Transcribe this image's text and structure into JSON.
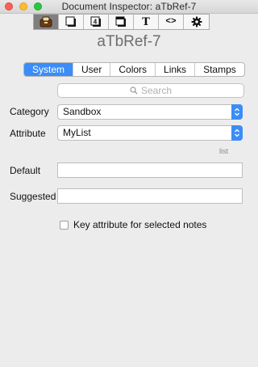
{
  "window": {
    "title": "Document Inspector: aTbRef-7"
  },
  "toolbar": {
    "buttons": [
      {
        "icon": "document-box-icon",
        "active": true
      },
      {
        "icon": "note-icon",
        "active": false
      },
      {
        "icon": "calendar-icon",
        "label": "4",
        "active": false
      },
      {
        "icon": "window-icon",
        "active": false
      },
      {
        "icon": "text-icon",
        "label": "T",
        "active": false
      },
      {
        "icon": "code-icon",
        "label": "<>",
        "active": false
      },
      {
        "icon": "gear-icon",
        "active": false
      }
    ]
  },
  "document_name": "aTbRef-7",
  "tabs": [
    {
      "label": "System",
      "active": true
    },
    {
      "label": "User",
      "active": false
    },
    {
      "label": "Colors",
      "active": false
    },
    {
      "label": "Links",
      "active": false
    },
    {
      "label": "Stamps",
      "active": false
    }
  ],
  "search": {
    "placeholder": "Search"
  },
  "form": {
    "category_label": "Category",
    "category_value": "Sandbox",
    "attribute_label": "Attribute",
    "attribute_value": "MyList",
    "attribute_type": "list",
    "default_label": "Default",
    "default_value": "",
    "suggested_label": "Suggested",
    "suggested_value": "",
    "key_attribute_label": "Key attribute for selected notes",
    "key_attribute_checked": false
  },
  "colors": {
    "accent": "#3b8df7"
  }
}
